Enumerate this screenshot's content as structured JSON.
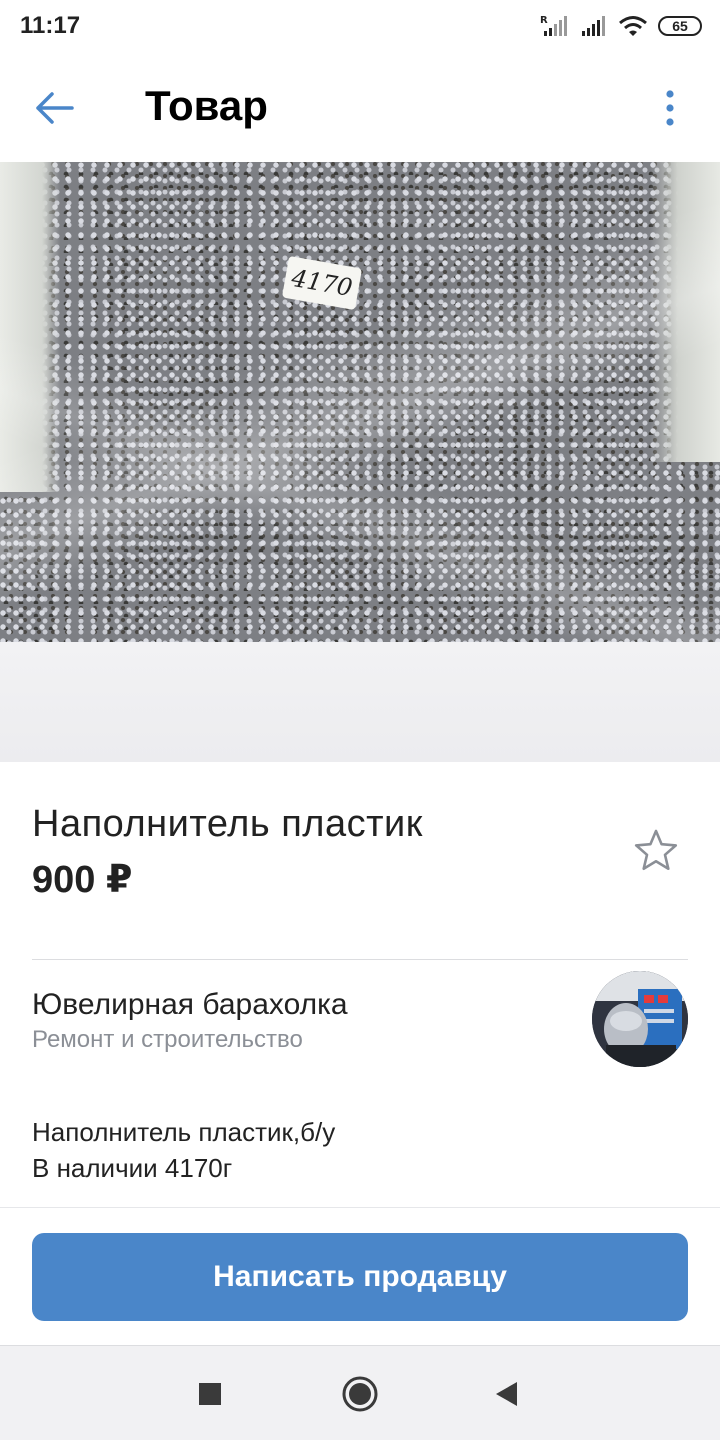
{
  "status_bar": {
    "time": "11:17",
    "battery": "65",
    "icons": [
      "signal-roaming-icon",
      "signal-icon",
      "wifi-icon",
      "battery-icon"
    ]
  },
  "header": {
    "title": "Товар",
    "back_icon": "arrow-left-icon",
    "more_icon": "more-vertical-icon"
  },
  "photo": {
    "label_text": "4170"
  },
  "product": {
    "title": "Наполнитель пластик",
    "price": "900 ₽",
    "favorite_icon": "star-icon"
  },
  "seller": {
    "name": "Ювелирная барахолка",
    "category": "Ремонт и строительство"
  },
  "description": {
    "lines": [
      "Наполнитель пластик,б/у",
      "В наличии 4170г"
    ]
  },
  "action": {
    "button_label": "Написать продавцу"
  },
  "colors": {
    "accent": "#4a86c9",
    "text": "#222222",
    "secondary_text": "#8b8f96"
  },
  "nav": {
    "icons": [
      "square-icon",
      "circle-icon",
      "triangle-back-icon"
    ]
  }
}
